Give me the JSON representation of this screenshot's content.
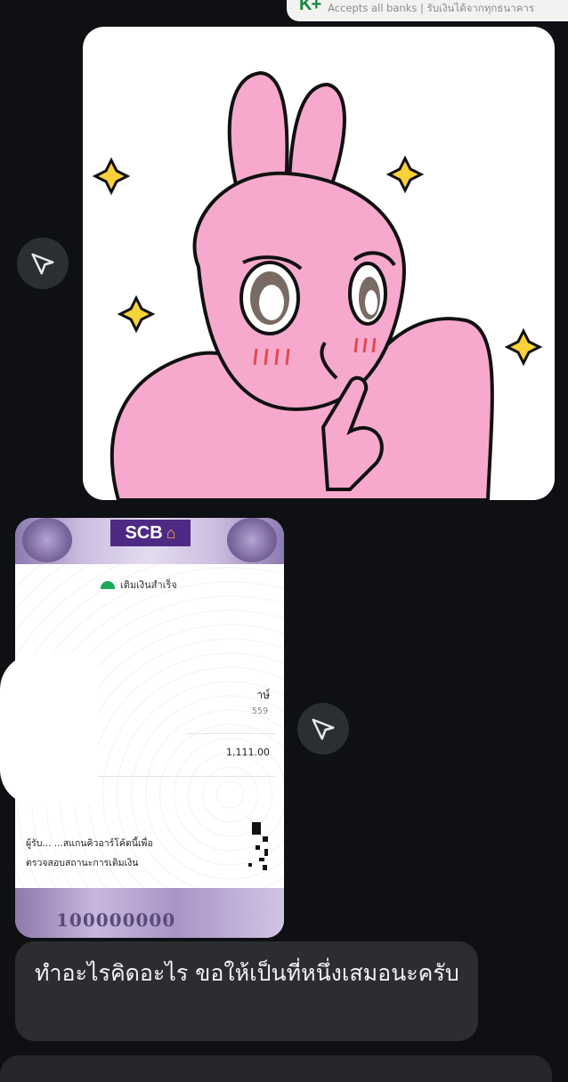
{
  "top_card": {
    "brand": "K+",
    "caption": "Accepts all banks | รับเงินได้จากทุกธนาคาร"
  },
  "slip": {
    "bank_logo": "SCB",
    "status": "เติมเงินสำเร็จ",
    "currency_fragment": "าษ์",
    "ref_fragment": "559",
    "amount": "1,111.00",
    "receiver_line1": "ผู้รับ...  ...สแกนคิวอาร์โค้ดนี้เพื่อ",
    "receiver_line2": "ตรวจสอบสถานะการเติมเงิน",
    "footer_digits": "100000000",
    "colors": {
      "brand_purple": "#4e2a84",
      "success_green": "#1aa85a"
    }
  },
  "message": {
    "text": "ทำอะไรคิดอะไร ขอให้เป็นที่หนึ่งเสมอนะครับ"
  },
  "icons": {
    "forward": "forward-icon"
  },
  "theme": {
    "background": "#0e1014",
    "bubble": "#2b2d31"
  }
}
